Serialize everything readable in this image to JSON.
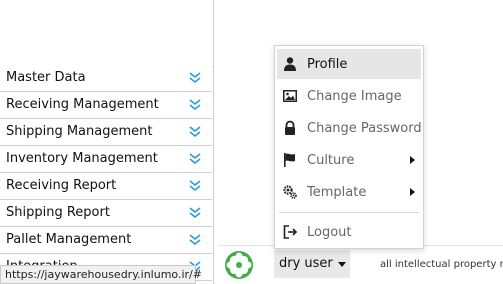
{
  "sidebar": {
    "items": [
      {
        "label": "Master Data"
      },
      {
        "label": "Receiving Management"
      },
      {
        "label": "Shipping Management"
      },
      {
        "label": "Inventory Management"
      },
      {
        "label": "Receiving Report"
      },
      {
        "label": "Shipping Report"
      },
      {
        "label": "Pallet Management"
      },
      {
        "label": "Integration"
      }
    ],
    "chevron_color": "#2a9bd6"
  },
  "user_menu": {
    "username": "dry user",
    "items": [
      {
        "label": "Profile",
        "icon": "user-icon",
        "active": true
      },
      {
        "label": "Change Image",
        "icon": "image-icon"
      },
      {
        "label": "Change Password",
        "icon": "lock-icon"
      },
      {
        "label": "Culture",
        "icon": "flag-icon",
        "submenu": true
      },
      {
        "label": "Template",
        "icon": "cogs-icon",
        "submenu": true
      },
      {
        "label": "Logout",
        "icon": "logout-icon"
      }
    ]
  },
  "footer": {
    "copyright": "all intellectual property r"
  },
  "status_bar": {
    "url": "https://jaywarehousedry.inlumo.ir/#"
  },
  "colors": {
    "logo_green": "#3fae49",
    "menu_active_bg": "#e6e6e6"
  }
}
